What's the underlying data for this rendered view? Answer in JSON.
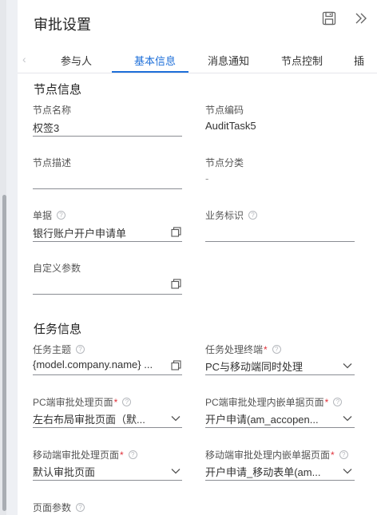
{
  "header": {
    "title": "审批设置"
  },
  "tabs": [
    {
      "label": "参与人"
    },
    {
      "label": "基本信息"
    },
    {
      "label": "消息通知"
    },
    {
      "label": "节点控制"
    },
    {
      "label": "插"
    }
  ],
  "node_info": {
    "section_title": "节点信息",
    "node_name": {
      "label": "节点名称",
      "value": "权签3"
    },
    "node_code": {
      "label": "节点编码",
      "value": "AuditTask5"
    },
    "node_desc": {
      "label": "节点描述",
      "value": ""
    },
    "node_category": {
      "label": "节点分类",
      "value": "-"
    },
    "document": {
      "label": "单据",
      "help": "?",
      "value": "银行账户开户申请单"
    },
    "biz_flag": {
      "label": "业务标识",
      "help": "?",
      "value": ""
    },
    "custom_params": {
      "label": "自定义参数",
      "value": ""
    }
  },
  "task_info": {
    "section_title": "任务信息",
    "task_subject": {
      "label": "任务主题",
      "help": "?",
      "value": "{model.company.name} ..."
    },
    "task_terminal": {
      "label": "任务处理终端",
      "required": "*",
      "help": "?",
      "value": "PC与移动端同时处理"
    },
    "pc_page": {
      "label": "PC端审批处理页面",
      "required": "*",
      "help": "?",
      "value": "左右布局审批页面（默..."
    },
    "pc_embed_page": {
      "label": "PC端审批处理内嵌单据页面",
      "required": "*",
      "help": "?",
      "value": "开户申请(am_accopen..."
    },
    "mobile_page": {
      "label": "移动端审批处理页面",
      "required": "*",
      "help": "?",
      "value": "默认审批页面"
    },
    "mobile_embed_page": {
      "label": "移动端审批处理内嵌单据页面",
      "required": "*",
      "help": "?",
      "value": "开户申请_移动表单(am..."
    },
    "page_params": {
      "label": "页面参数",
      "help": "?"
    }
  },
  "colors": {
    "accent": "#1e6fd9",
    "required": "#e0313a"
  }
}
